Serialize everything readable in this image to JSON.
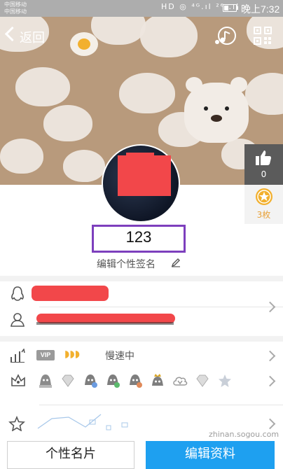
{
  "status_bar": {
    "carrier_1": "中国移动",
    "carrier_2": "中国移动",
    "icons": "HD  ◎ ⁴ᴳ.ıl ²⁶ .ıl",
    "battery_level": 0.35,
    "time": "晚上7:32"
  },
  "header": {
    "back_label": "返回",
    "music_icon": "music-note-icon",
    "qr_icon": "qr-code-icon"
  },
  "side_panel": {
    "like_count": "0",
    "star_count": "3枚"
  },
  "profile": {
    "name": "123",
    "signature": "编辑个性签名"
  },
  "info_rows": {
    "qq_icon": "penguin-icon",
    "person_icon": "person-icon"
  },
  "level_row": {
    "vip": "VIP",
    "moons": "◗◗◗",
    "speed": "慢速中"
  },
  "watermark": "zhinan.sogou.com",
  "buttons": {
    "card": "个性名片",
    "edit": "编辑资料"
  },
  "colors": {
    "accent_blue": "#1ea0f0",
    "highlight_purple": "#7d3fbd",
    "redaction_red": "#f2474a",
    "gold": "#f2b02e"
  }
}
